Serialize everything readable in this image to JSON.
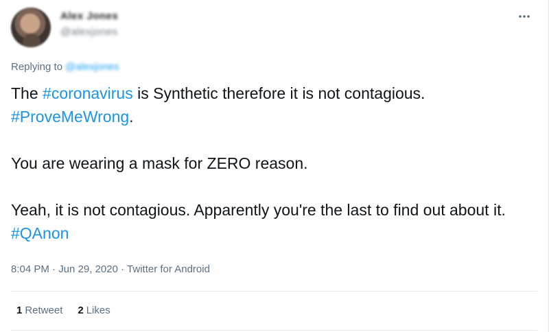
{
  "user": {
    "name": "Alex Jones",
    "handle": "@alexjones"
  },
  "reply": {
    "prefix": "Replying to",
    "mention": "@alexjones"
  },
  "tweet": {
    "l1_text_a": "The ",
    "l1_hashtag": "#coronavirus",
    "l1_text_b": " is Synthetic therefore it is not contagious.",
    "l2_hashtag": "#ProveMeWrong",
    "l2_text": ".",
    "l3_text": "You are wearing a mask for ZERO reason.",
    "l4_text": "Yeah, it is not contagious. Apparently you're the last to find out about it. ",
    "l4_hashtag": "#QAnon"
  },
  "meta": {
    "time": "8:04 PM",
    "sep1": " · ",
    "date": "Jun 29, 2020",
    "sep2": " · ",
    "source": "Twitter for Android"
  },
  "stats": {
    "retweets_count": "1",
    "retweets_label": "Retweet",
    "likes_count": "2",
    "likes_label": "Likes"
  },
  "icons": {
    "more": "more-horizontal-icon"
  },
  "colors": {
    "link": "#1b95e0",
    "muted": "#5b7083",
    "text": "#0f1419",
    "divider": "#e6ecf0"
  }
}
